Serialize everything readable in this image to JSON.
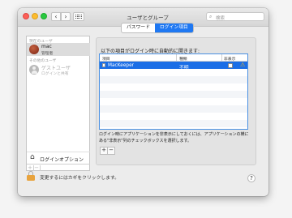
{
  "window": {
    "title": "ユーザとグループ"
  },
  "search": {
    "placeholder": "検索"
  },
  "sidebar": {
    "current_user_header": "現在のユーザ",
    "other_users_header": "その他のユーザ",
    "users": [
      {
        "name": "mac",
        "role": "管理者"
      },
      {
        "name": "ゲストユーザ",
        "role": "ログインと共有"
      }
    ],
    "login_options_label": "ログインオプション",
    "add_label": "+",
    "remove_label": "−"
  },
  "tabs": [
    {
      "label": "パスワード"
    },
    {
      "label": "ログイン項目"
    }
  ],
  "login_items": {
    "instruction": "以下の項目がログイン時に自動的に開きます:",
    "columns": [
      "項目",
      "種類",
      "非表示"
    ],
    "rows": [
      {
        "item": "MacKeeper",
        "kind": "不明",
        "hidden": false
      }
    ],
    "note": "ログイン時にアプリケーションを非表示にしておくには、アプリケーションの横にある\"非表示\"列のチェックボックスを選択します。",
    "add_label": "+",
    "remove_label": "−"
  },
  "footer": {
    "lock_text": "変更するにはカギをクリックします。",
    "help_label": "?"
  },
  "colors": {
    "accent": "#1f78f2",
    "selection": "#1b6ee6",
    "lock": "#e8a33d",
    "warning": "#f2b81c"
  }
}
